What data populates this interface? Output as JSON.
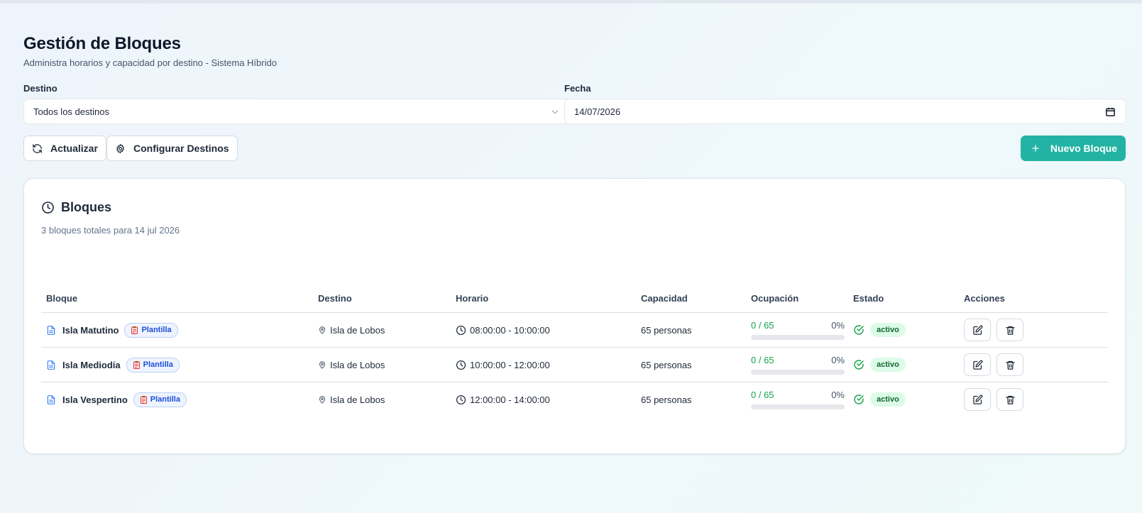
{
  "header": {
    "title": "Gestión de Bloques",
    "subtitle": "Administra horarios y capacidad por destino - Sistema Híbrido"
  },
  "filters": {
    "destino_label": "Destino",
    "destino_value": "Todos los destinos",
    "fecha_label": "Fecha",
    "fecha_value": "14/07/2026"
  },
  "toolbar": {
    "refresh_label": "Actualizar",
    "configure_label": "Configurar Destinos",
    "new_label": "Nuevo Bloque"
  },
  "card": {
    "title": "Bloques",
    "subtitle": "3 bloques totales para 14 jul 2026"
  },
  "table": {
    "columns": [
      "Bloque",
      "Destino",
      "Horario",
      "Capacidad",
      "Ocupación",
      "Estado",
      "Acciones"
    ],
    "rows": [
      {
        "name": "Isla Matutino",
        "badge": "Plantilla",
        "destino": "Isla de Lobos",
        "horario": "08:00:00 - 10:00:00",
        "capacidad": "65 personas",
        "ocupacion": "0 / 65",
        "porcentaje": "0%",
        "ocupacion_fraction": 0,
        "estado": "activo"
      },
      {
        "name": "Isla Mediodía",
        "badge": "Plantilla",
        "destino": "Isla de Lobos",
        "horario": "10:00:00 - 12:00:00",
        "capacidad": "65 personas",
        "ocupacion": "0 / 65",
        "porcentaje": "0%",
        "ocupacion_fraction": 0,
        "estado": "activo"
      },
      {
        "name": "Isla Vespertino",
        "badge": "Plantilla",
        "destino": "Isla de Lobos",
        "horario": "12:00:00 - 14:00:00",
        "capacidad": "65 personas",
        "ocupacion": "0 / 65",
        "porcentaje": "0%",
        "ocupacion_fraction": 0,
        "estado": "activo"
      }
    ]
  },
  "colors": {
    "primary": "#22b3a4",
    "badge_blue": "#1d4ed8",
    "success": "#16a34a",
    "status_bg": "#dcfce7"
  },
  "icons": {
    "refresh": "refresh-icon",
    "settings": "gear-icon",
    "add": "plus-icon",
    "clock": "clock-icon",
    "document": "document-icon",
    "location": "map-pin-icon",
    "check": "check-circle-icon",
    "edit": "edit-icon",
    "delete": "trash-icon"
  }
}
